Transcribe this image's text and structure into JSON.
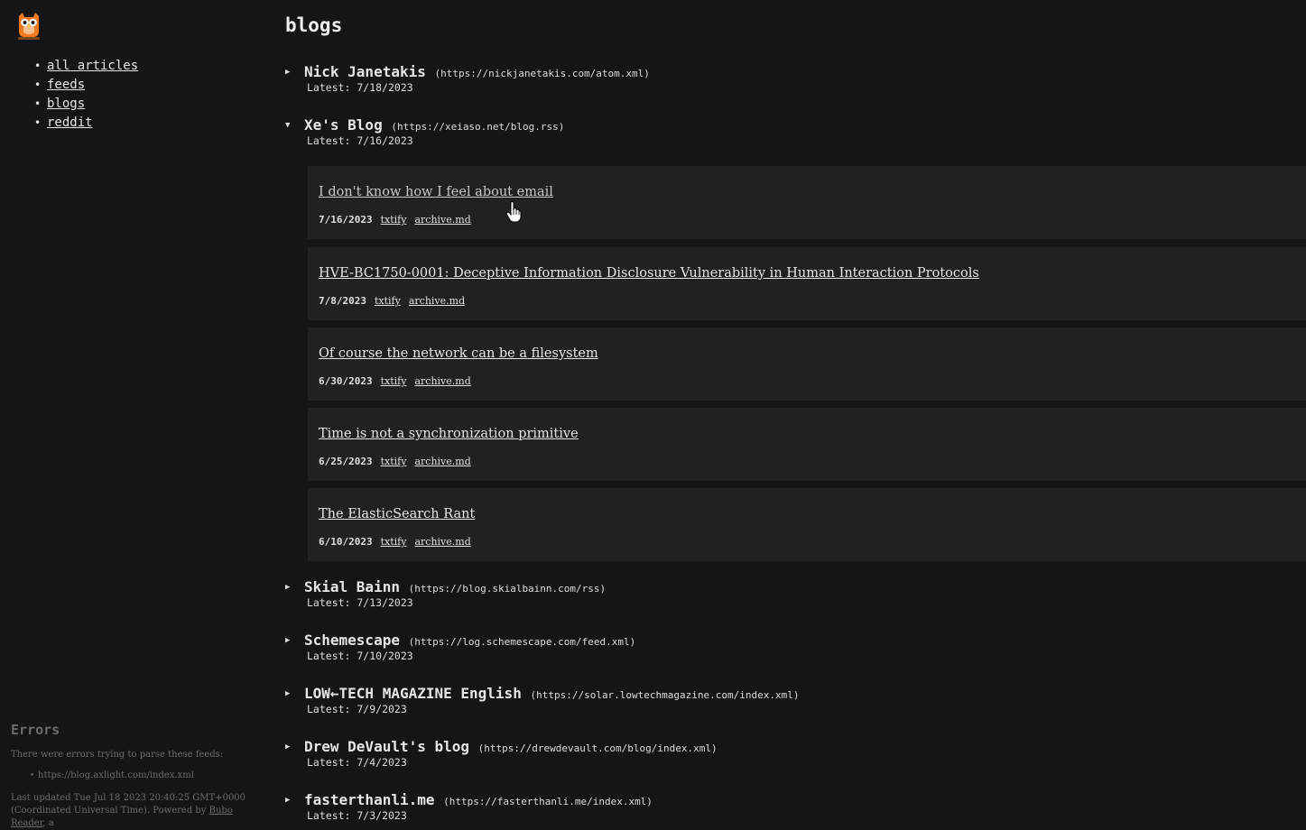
{
  "sidebar": {
    "nav": [
      {
        "label": "all articles"
      },
      {
        "label": "feeds"
      },
      {
        "label": "blogs"
      },
      {
        "label": "reddit"
      }
    ],
    "errors": {
      "title": "Errors",
      "message": "There were errors trying to parse these feeds:",
      "items": [
        "https://blog.axlight.com/index.xml"
      ],
      "footer_prefix": "Last updated Tue Jul 18 2023 20:40:25 GMT+0000 (Coordinated Universal Time). Powered by ",
      "footer_link": "Bubo Reader",
      "footer_suffix": ", a"
    }
  },
  "page": {
    "title": "blogs"
  },
  "feeds": [
    {
      "name": "Nick Janetakis",
      "url": "(https://nickjanetakis.com/atom.xml)",
      "latest": "Latest: 7/18/2023",
      "expanded": false
    },
    {
      "name": "Xe's Blog",
      "url": "(https://xeiaso.net/blog.rss)",
      "latest": "Latest: 7/16/2023",
      "expanded": true,
      "articles": [
        {
          "title": "I don't know how I feel about email",
          "date": "7/16/2023",
          "link1": "txtify",
          "link2": "archive.md"
        },
        {
          "title": "HVE-BC1750-0001: Deceptive Information Disclosure Vulnerability in Human Interaction Protocols",
          "date": "7/8/2023",
          "link1": "txtify",
          "link2": "archive.md"
        },
        {
          "title": "Of course the network can be a filesystem",
          "date": "6/30/2023",
          "link1": "txtify",
          "link2": "archive.md"
        },
        {
          "title": "Time is not a synchronization primitive",
          "date": "6/25/2023",
          "link1": "txtify",
          "link2": "archive.md"
        },
        {
          "title": "The ElasticSearch Rant",
          "date": "6/10/2023",
          "link1": "txtify",
          "link2": "archive.md"
        }
      ]
    },
    {
      "name": "Skial Bainn",
      "url": "(https://blog.skialbainn.com/rss)",
      "latest": "Latest: 7/13/2023",
      "expanded": false
    },
    {
      "name": "Schemescape",
      "url": "(https://log.schemescape.com/feed.xml)",
      "latest": "Latest: 7/10/2023",
      "expanded": false
    },
    {
      "name": "LOW←TECH MAGAZINE English",
      "url": "(https://solar.lowtechmagazine.com/index.xml)",
      "latest": "Latest: 7/9/2023",
      "expanded": false
    },
    {
      "name": "Drew DeVault's blog",
      "url": "(https://drewdevault.com/blog/index.xml)",
      "latest": "Latest: 7/4/2023",
      "expanded": false
    },
    {
      "name": "fasterthanli.me",
      "url": "(https://fasterthanli.me/index.xml)",
      "latest": "Latest: 7/3/2023",
      "expanded": false
    }
  ],
  "icons": {
    "logo": "owl-logo-icon",
    "collapsed": "triangle-right-icon",
    "expanded": "triangle-down-icon",
    "cursor": "hand-pointer-icon"
  },
  "colors": {
    "background": "#151515",
    "card": "#212121",
    "text": "#e6e6e6",
    "muted": "#6b6b6b"
  }
}
